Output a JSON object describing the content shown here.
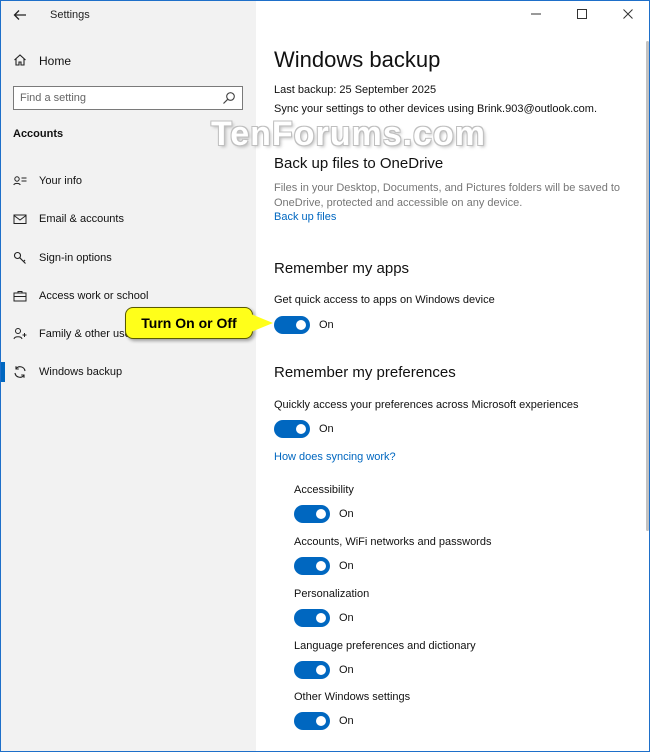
{
  "window": {
    "title": "Settings"
  },
  "sidebar": {
    "home_label": "Home",
    "search_placeholder": "Find a setting",
    "section": "Accounts",
    "items": [
      {
        "label": "Your info",
        "icon": "person-list-icon"
      },
      {
        "label": "Email & accounts",
        "icon": "mail-icon"
      },
      {
        "label": "Sign-in options",
        "icon": "key-icon"
      },
      {
        "label": "Access work or school",
        "icon": "briefcase-icon"
      },
      {
        "label": "Family & other use",
        "icon": "person-add-icon"
      },
      {
        "label": "Windows backup",
        "icon": "sync-icon",
        "active": true
      }
    ]
  },
  "main": {
    "title": "Windows backup",
    "last_backup": "Last backup: 25 September 2025",
    "sync_text": "Sync your settings to other devices using Brink.903@outlook.com.",
    "onedrive": {
      "heading": "Back up files to OneDrive",
      "description": "Files in your Desktop, Documents, and Pictures folders will be saved to OneDrive, protected and accessible on any device.",
      "link": "Back up files"
    },
    "apps": {
      "heading": "Remember my apps",
      "label": "Get quick access to apps on Windows device",
      "state": "On"
    },
    "preferences": {
      "heading": "Remember my preferences",
      "label": "Quickly access your preferences across Microsoft experiences",
      "state": "On",
      "link": "How does syncing work?",
      "sub": [
        {
          "label": "Accessibility",
          "state": "On"
        },
        {
          "label": "Accounts, WiFi networks and passwords",
          "state": "On"
        },
        {
          "label": "Personalization",
          "state": "On"
        },
        {
          "label": "Language preferences and dictionary",
          "state": "On"
        },
        {
          "label": "Other Windows settings",
          "state": "On"
        }
      ]
    }
  },
  "watermark": "TenForums.com",
  "callout": "Turn On or Off",
  "colors": {
    "accent": "#0067c0",
    "callout": "#ffff1a"
  }
}
